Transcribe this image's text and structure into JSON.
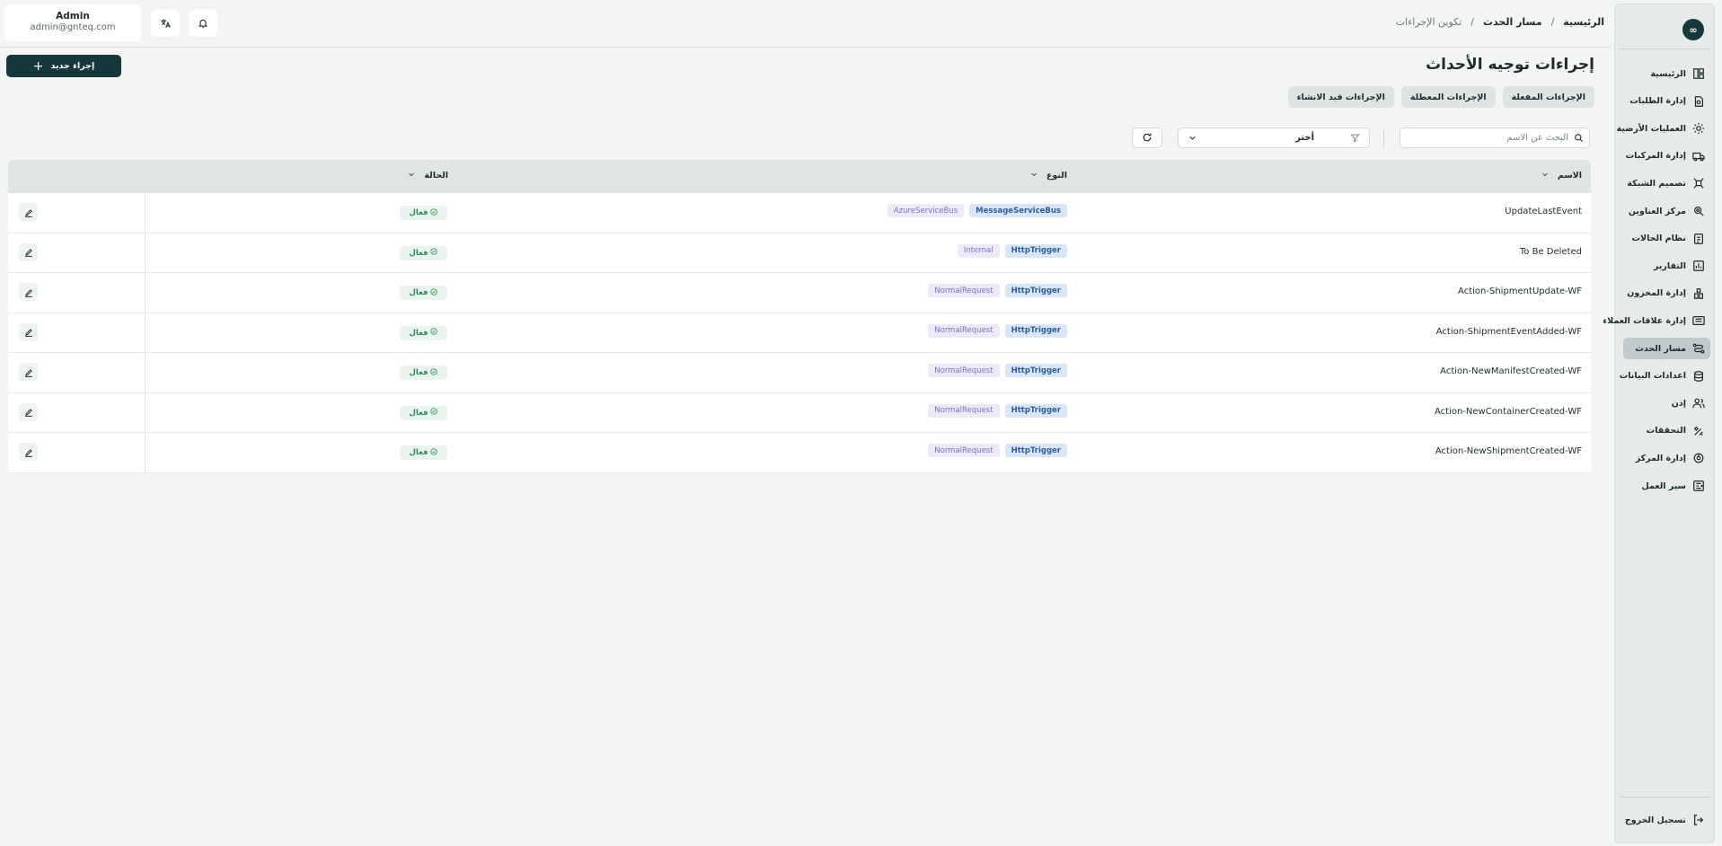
{
  "sidebar": {
    "logo": "∞",
    "items": [
      {
        "label": "الرئيسية",
        "icon": "home-grid-icon"
      },
      {
        "label": "إدارة الطلبات",
        "icon": "orders-icon"
      },
      {
        "label": "العمليات الأرضية",
        "icon": "ground-ops-icon"
      },
      {
        "label": "إدارة المركبات",
        "icon": "truck-icon"
      },
      {
        "label": "تصميم الشبكة",
        "icon": "network-icon"
      },
      {
        "label": "مركز العناوين",
        "icon": "address-icon"
      },
      {
        "label": "نظام الحالات",
        "icon": "status-system-icon"
      },
      {
        "label": "التقارير",
        "icon": "chart-icon"
      },
      {
        "label": "إدارة المخزون",
        "icon": "inventory-icon"
      },
      {
        "label": "إدارة علاقات العملاء",
        "icon": "crm-icon"
      },
      {
        "label": "مسار الحدث",
        "icon": "route-icon"
      },
      {
        "label": "اعدادات البيانات",
        "icon": "database-icon"
      },
      {
        "label": "إذن",
        "icon": "users-icon"
      },
      {
        "label": "التحققات",
        "icon": "tools-icon"
      },
      {
        "label": "إدارة المركز",
        "icon": "hub-icon"
      },
      {
        "label": "سير العمل",
        "icon": "workflow-icon"
      }
    ],
    "active_index": 10,
    "logout_label": "تسجيل الخروج"
  },
  "header": {
    "user_name": "Admin",
    "user_email": "admin@gnteq.com",
    "breadcrumb": {
      "home": "الرئيسية",
      "section": "مسار الحدث",
      "current": "تكوين الإجراءات",
      "sep": "/"
    }
  },
  "page": {
    "title": "إجراءات توجيه الأحداث",
    "new_button": "إجراء جديد",
    "tabs": [
      "الإجراءات المفعلة",
      "الإجراءات المعطلة",
      "الإجراءات قيد الانشاء"
    ]
  },
  "filters": {
    "search_placeholder": "البحث عن الاسم",
    "select_value": "أختر"
  },
  "table": {
    "columns": {
      "name": "الاسم",
      "type": "النوع",
      "status": "الحالة"
    },
    "rows": [
      {
        "name": "UpdateLastEvent",
        "type_primary": "MessageServiceBus",
        "type_secondary": "AzureServiceBus",
        "status": "فعال"
      },
      {
        "name": "To Be Deleted",
        "type_primary": "HttpTrigger",
        "type_secondary": "Internal",
        "status": "فعال"
      },
      {
        "name": "Action-ShipmentUpdate-WF",
        "type_primary": "HttpTrigger",
        "type_secondary": "NormalRequest",
        "status": "فعال"
      },
      {
        "name": "Action-ShipmentEventAdded-WF",
        "type_primary": "HttpTrigger",
        "type_secondary": "NormalRequest",
        "status": "فعال"
      },
      {
        "name": "Action-NewManifestCreated-WF",
        "type_primary": "HttpTrigger",
        "type_secondary": "NormalRequest",
        "status": "فعال"
      },
      {
        "name": "Action-NewContainerCreated-WF",
        "type_primary": "HttpTrigger",
        "type_secondary": "NormalRequest",
        "status": "فعال"
      },
      {
        "name": "Action-NewShipmentCreated-WF",
        "type_primary": "HttpTrigger",
        "type_secondary": "NormalRequest",
        "status": "فعال"
      }
    ]
  }
}
